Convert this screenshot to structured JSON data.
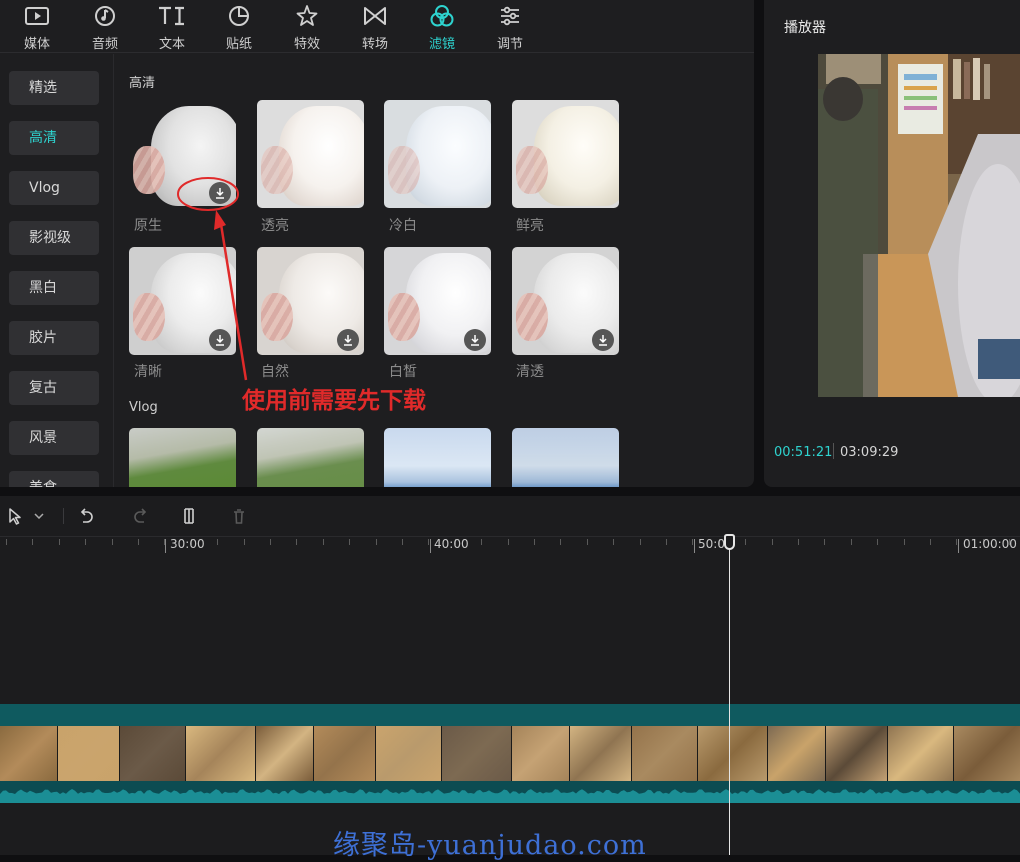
{
  "toolbar": {
    "tabs": [
      {
        "label": "媒体",
        "icon": "media-icon"
      },
      {
        "label": "音频",
        "icon": "audio-icon"
      },
      {
        "label": "文本",
        "icon": "text-icon"
      },
      {
        "label": "贴纸",
        "icon": "sticker-icon"
      },
      {
        "label": "特效",
        "icon": "effects-icon"
      },
      {
        "label": "转场",
        "icon": "transition-icon"
      },
      {
        "label": "滤镜",
        "icon": "filter-icon",
        "active": true
      },
      {
        "label": "调节",
        "icon": "adjust-icon"
      }
    ]
  },
  "sidebar": {
    "items": [
      "精选",
      "高清",
      "Vlog",
      "影视级",
      "黑白",
      "胶片",
      "复古",
      "风景",
      "美食"
    ],
    "active": "高清"
  },
  "filters": {
    "sections": [
      {
        "title": "高清",
        "items": [
          "原生",
          "透亮",
          "冷白",
          "鲜亮",
          "清晰",
          "自然",
          "白皙",
          "清透"
        ]
      },
      {
        "title": "Vlog",
        "items": []
      }
    ]
  },
  "annotation": {
    "text": "使用前需要先下载",
    "color": "#e02a2a"
  },
  "player": {
    "title": "播放器",
    "current_time": "00:51:21",
    "total_time": "03:09:29"
  },
  "timeline": {
    "ruler_labels": [
      "30:00",
      "40:00",
      "50:00",
      "01:00:00"
    ],
    "tools": [
      "select-icon",
      "dropdown-icon",
      "undo-icon",
      "redo-icon",
      "split-icon",
      "delete-icon"
    ]
  },
  "watermark": "缘聚岛-yuanjudao.com",
  "colors": {
    "accent": "#2ed3cf",
    "panel": "#1e1e20",
    "track": "#0f5a5f"
  }
}
